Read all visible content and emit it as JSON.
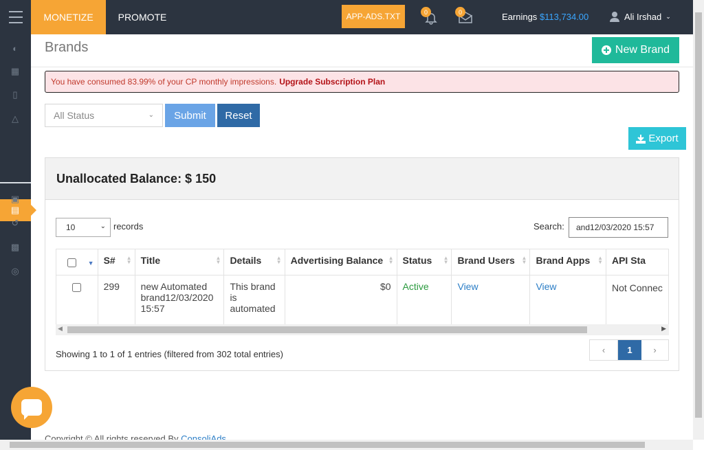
{
  "topbar": {
    "tabs": [
      "MONETIZE",
      "PROMOTE"
    ],
    "app_ads_label": "APP-ADS.TXT",
    "notifications_count": "0",
    "messages_count": "0",
    "earnings_label": "Earnings",
    "earnings_value": "$113,734.00",
    "user_name": "Ali Irshad"
  },
  "page": {
    "title": "Brands",
    "new_brand_label": "New Brand",
    "alert_text": "You have consumed 83.99% of your CP monthly impressions.",
    "alert_link": "Upgrade Subscription Plan"
  },
  "filters": {
    "status_value": "All Status",
    "submit_label": "Submit",
    "reset_label": "Reset",
    "export_label": "Export"
  },
  "panel": {
    "title": "Unallocated Balance: $ 150",
    "page_length": "10",
    "records_label": "records",
    "search_label": "Search:",
    "search_value": "and12/03/2020 15:57"
  },
  "table": {
    "headers": [
      "S#",
      "Title",
      "Details",
      "Advertising Balance",
      "Status",
      "Brand Users",
      "Brand Apps",
      "API Sta"
    ],
    "rows": [
      {
        "sn": "299",
        "title": "new Automated brand12/03/2020 15:57",
        "details": "This brand is automated",
        "balance": "$0",
        "status": "Active",
        "users": "View",
        "apps": "View",
        "api": "Not Connec"
      }
    ]
  },
  "pagination": {
    "info": "Showing 1 to 1 of 1 entries (filtered from 302 total entries)",
    "prev": "‹",
    "current": "1",
    "next": "›"
  },
  "footer": {
    "text": "Copyright © All rights reserved By",
    "link": "ConsoliAds"
  },
  "colors": {
    "accent": "#f6a535",
    "sidebar": "#2c3440",
    "primary": "#2f6aa6",
    "success": "#1fb99a",
    "info": "#2ec5d7"
  }
}
